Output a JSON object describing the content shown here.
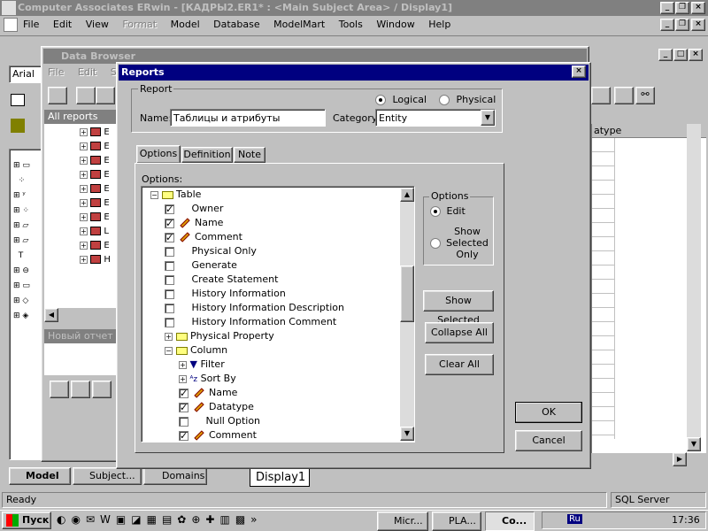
{
  "app": {
    "title": "Computer Associates ERwin - [КАДРЫ2.ER1* : <Main Subject Area> / Display1]",
    "menu": [
      "File",
      "Edit",
      "View",
      "Format",
      "Model",
      "Database",
      "ModelMart",
      "Tools",
      "Window",
      "Help"
    ],
    "font_box": "Arial",
    "status": "Ready",
    "status_right": "SQL Server",
    "bottom_tabs": [
      "Model",
      "Subject...",
      "Domains"
    ],
    "display_tab": "Display1",
    "right_header": "atype"
  },
  "data_browser": {
    "title": "Data Browser",
    "menu": [
      "File",
      "Edit",
      "Se"
    ],
    "all_reports": "All reports",
    "new_report": "Новый отчет",
    "tree_prefix": [
      "E",
      "E",
      "E",
      "E",
      "E",
      "E",
      "E",
      "L",
      "E",
      "H"
    ]
  },
  "reports": {
    "title": "Reports",
    "report_group": "Report",
    "name_label": "Name:",
    "name_value": "Таблицы и атрибуты",
    "category_label": "Category:",
    "category_value": "Entity",
    "logical": "Logical",
    "physical": "Physical",
    "tabs": [
      "Options",
      "Definition",
      "Note"
    ],
    "options_label": "Options:",
    "tree": [
      {
        "indent": 0,
        "pm": "−",
        "check": null,
        "icon": "folder",
        "label": "Table"
      },
      {
        "indent": 1,
        "pm": null,
        "check": true,
        "icon": null,
        "label": "Owner"
      },
      {
        "indent": 1,
        "pm": null,
        "check": true,
        "icon": "pencil",
        "label": "Name"
      },
      {
        "indent": 1,
        "pm": null,
        "check": true,
        "icon": "pencil",
        "label": "Comment"
      },
      {
        "indent": 1,
        "pm": null,
        "check": false,
        "icon": null,
        "label": "Physical Only"
      },
      {
        "indent": 1,
        "pm": null,
        "check": false,
        "icon": null,
        "label": "Generate"
      },
      {
        "indent": 1,
        "pm": null,
        "check": false,
        "icon": null,
        "label": "Create Statement"
      },
      {
        "indent": 1,
        "pm": null,
        "check": false,
        "icon": null,
        "label": "History Information"
      },
      {
        "indent": 1,
        "pm": null,
        "check": false,
        "icon": null,
        "label": "History Information Description"
      },
      {
        "indent": 1,
        "pm": null,
        "check": false,
        "icon": null,
        "label": "History Information Comment"
      },
      {
        "indent": 1,
        "pm": "+",
        "check": null,
        "icon": "folder",
        "label": "Physical Property"
      },
      {
        "indent": 1,
        "pm": "−",
        "check": null,
        "icon": "folder",
        "label": "Column"
      },
      {
        "indent": 2,
        "pm": "+",
        "check": null,
        "icon": "filter",
        "label": "Filter"
      },
      {
        "indent": 2,
        "pm": "+",
        "check": null,
        "icon": "sort",
        "label": "Sort By"
      },
      {
        "indent": 2,
        "pm": null,
        "check": true,
        "icon": "pencil",
        "label": "Name"
      },
      {
        "indent": 2,
        "pm": null,
        "check": true,
        "icon": "pencil",
        "label": "Datatype"
      },
      {
        "indent": 2,
        "pm": null,
        "check": false,
        "icon": null,
        "label": "Null Option"
      },
      {
        "indent": 2,
        "pm": null,
        "check": true,
        "icon": "pencil",
        "label": "Comment"
      }
    ],
    "options_group": "Options",
    "opt_edit": "Edit",
    "opt_show_selected": "Show Selected Only",
    "btn_show_selected": "Show Selected",
    "btn_collapse_all": "Collapse All",
    "btn_clear_all": "Clear All",
    "btn_ok": "OK",
    "btn_cancel": "Cancel"
  },
  "taskbar": {
    "start": "Пуск",
    "tasks": [
      "Micr...",
      "PLA...",
      "Co..."
    ],
    "clock": "17:36",
    "lang": "Ru"
  }
}
